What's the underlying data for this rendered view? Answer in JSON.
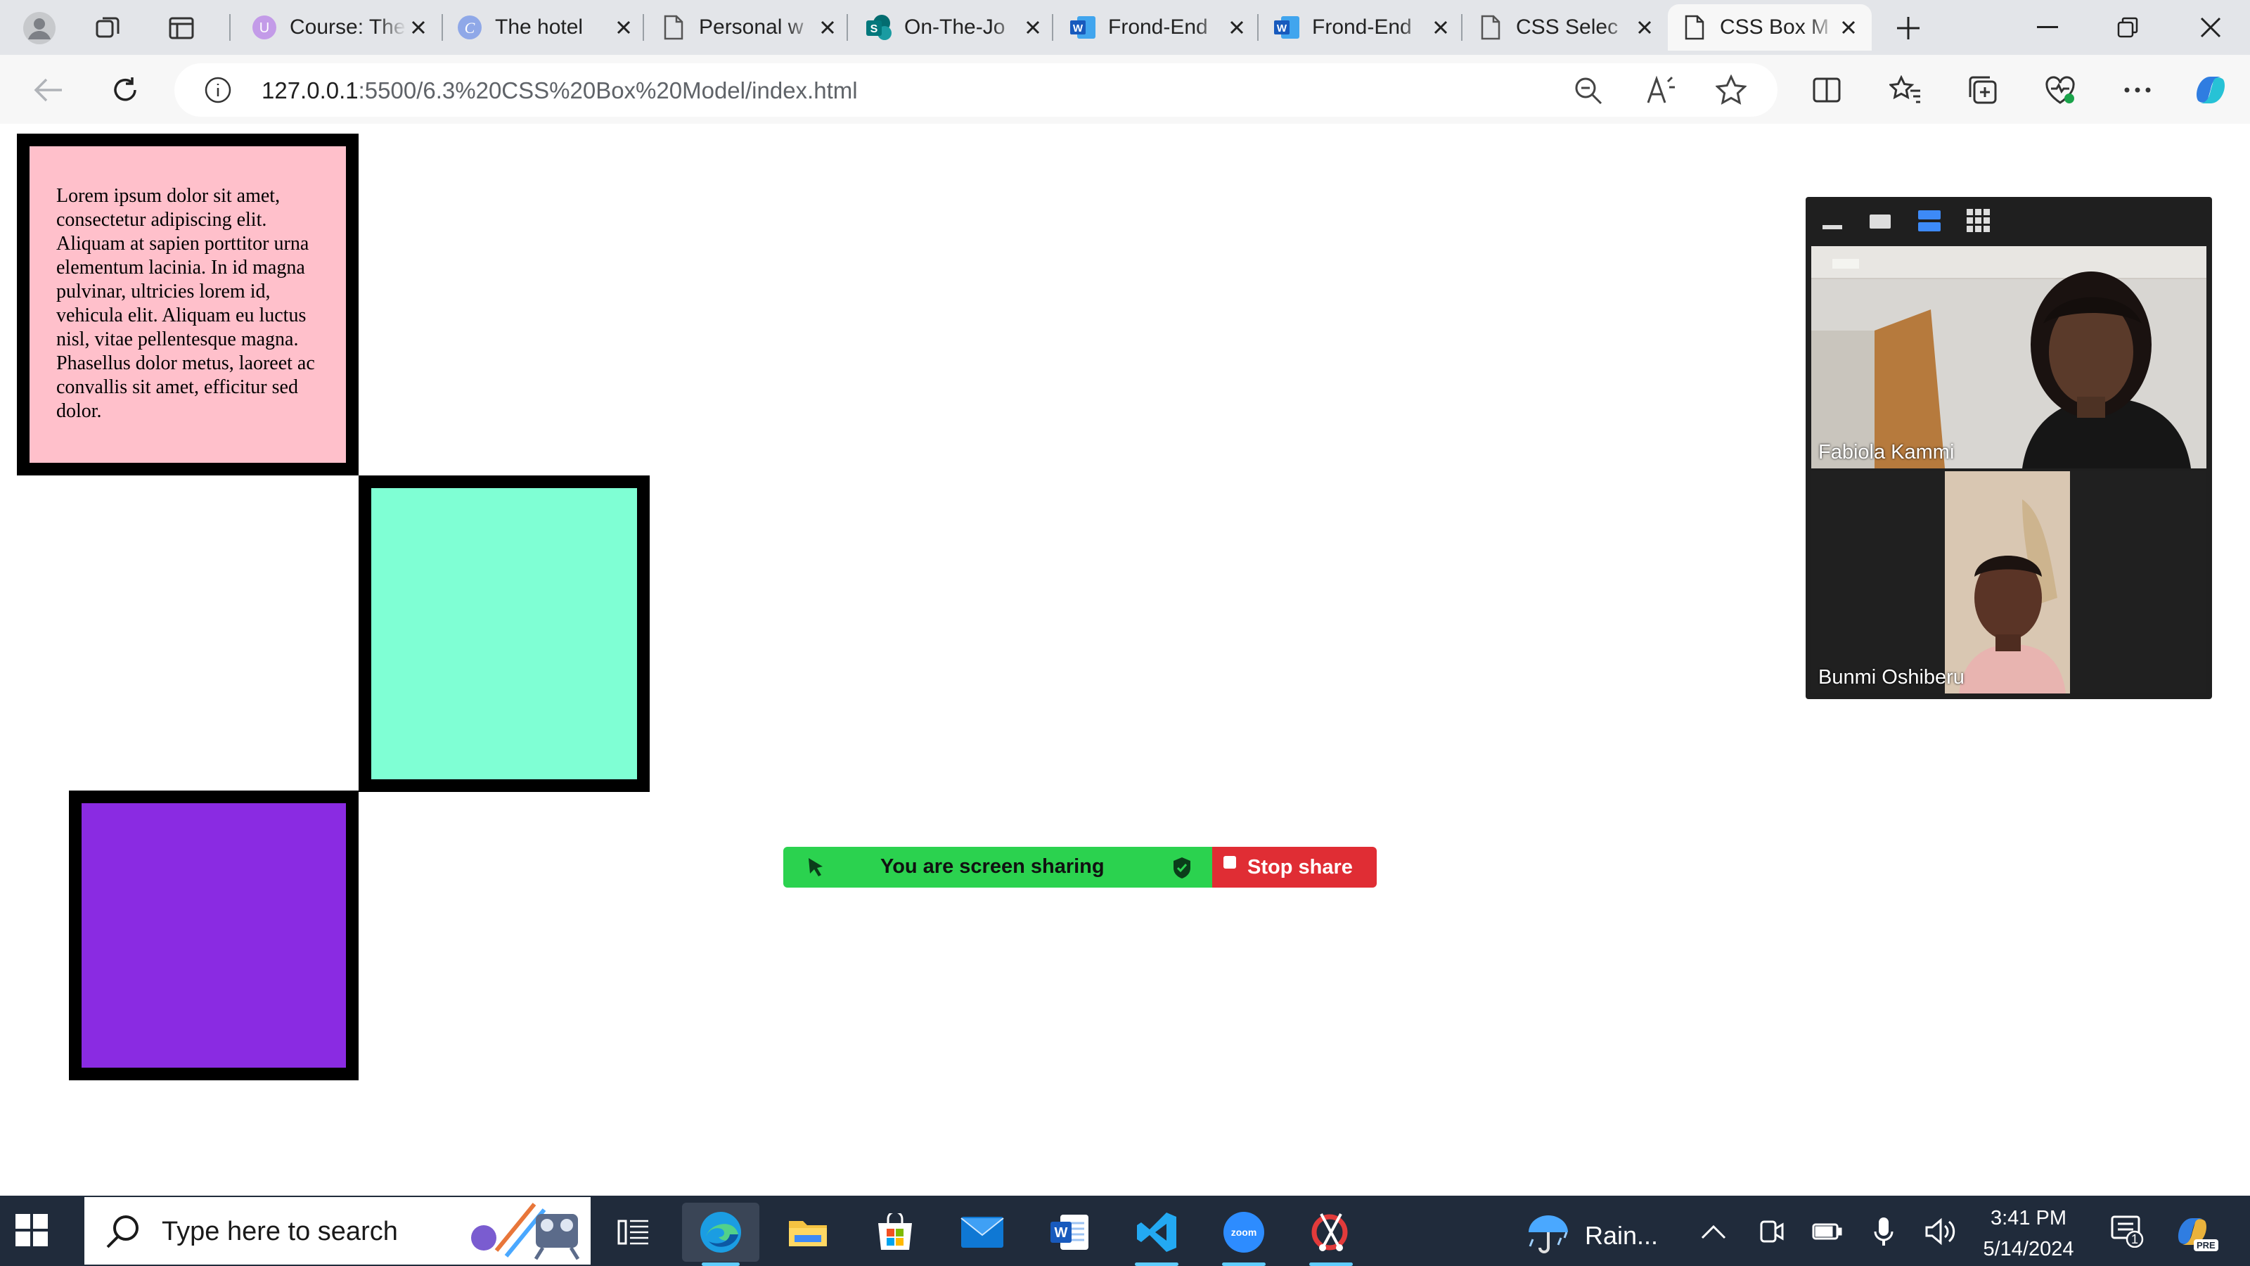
{
  "browser": {
    "tabs": [
      {
        "title": "Course: The",
        "favicon": "course-icon"
      },
      {
        "title": "The hotel",
        "favicon": "canva-icon"
      },
      {
        "title": "Personal w",
        "favicon": "page-icon"
      },
      {
        "title": "On-The-Jo",
        "favicon": "sharepoint-icon"
      },
      {
        "title": "Frond-End",
        "favicon": "word-icon"
      },
      {
        "title": "Frond-End",
        "favicon": "word-icon"
      },
      {
        "title": "CSS Selec",
        "favicon": "page-icon"
      },
      {
        "title": "CSS Box M",
        "favicon": "page-icon",
        "active": true
      }
    ],
    "address": {
      "host": "127.0.0.1",
      "path": ":5500/6.3%20CSS%20Box%20Model/index.html"
    }
  },
  "page": {
    "box1_text": "Lorem ipsum dolor sit amet, consectetur adipiscing elit. Aliquam at sapien porttitor urna elementum lacinia. In id magna pulvinar, ultricies lorem id, vehicula elit. Aliquam eu luctus nisl, vitae pellentesque magna. Phasellus dolor metus, laoreet ac convallis sit amet, efficitur sed dolor.",
    "colors": {
      "box1": "#ffc0cb",
      "box2": "#7fffd4",
      "box3": "#8a2be2",
      "border": "#000000"
    }
  },
  "zoom": {
    "share_text": "You are screen sharing",
    "stop_label": "Stop share",
    "participants": [
      {
        "name": "Fabiola Kammi"
      },
      {
        "name": "Bunmi Oshiberu"
      }
    ],
    "colors": {
      "share_bar": "#2bd24f",
      "stop": "#e02d34"
    }
  },
  "taskbar": {
    "search_placeholder": "Type here to search",
    "weather": "Rain...",
    "time": "3:41 PM",
    "date": "5/14/2024",
    "notification_count": "1",
    "copilot_badge": "PRE"
  }
}
